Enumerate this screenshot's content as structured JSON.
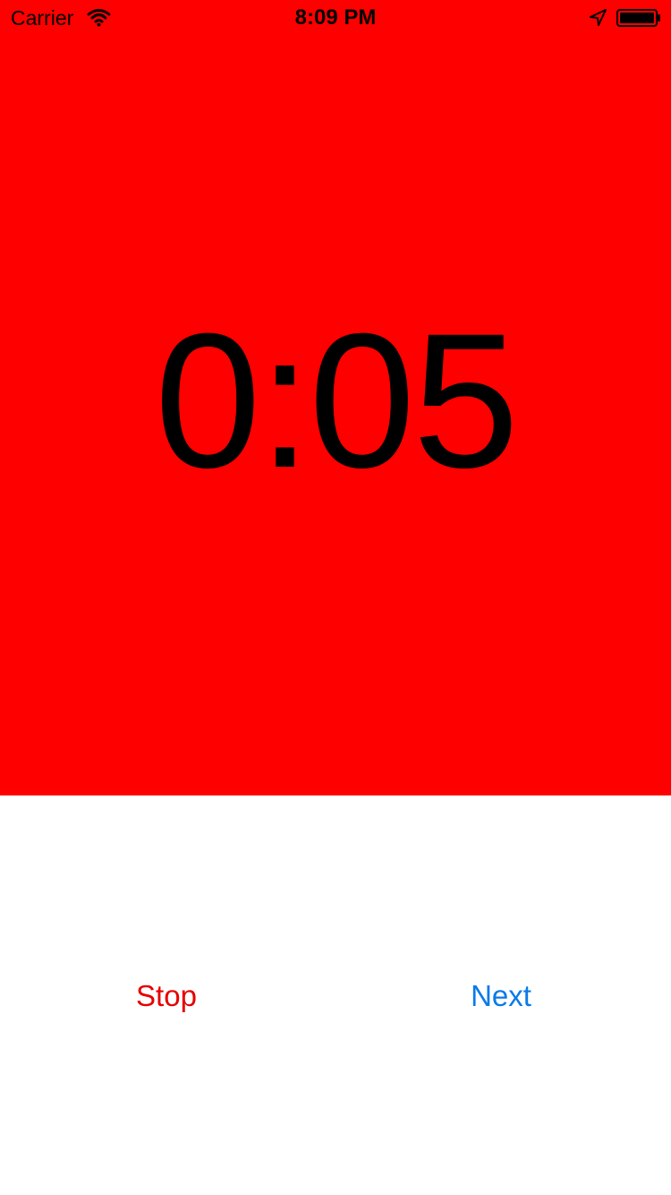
{
  "status_bar": {
    "carrier": "Carrier",
    "time": "8:09 PM",
    "icons": [
      "wifi-icon",
      "location-arrow-icon",
      "battery-icon"
    ]
  },
  "timer": {
    "display": "0:05",
    "background_color": "#ff0000"
  },
  "actions": {
    "stop_label": "Stop",
    "next_label": "Next",
    "stop_color": "#e60000",
    "next_color": "#0a7ae8"
  }
}
